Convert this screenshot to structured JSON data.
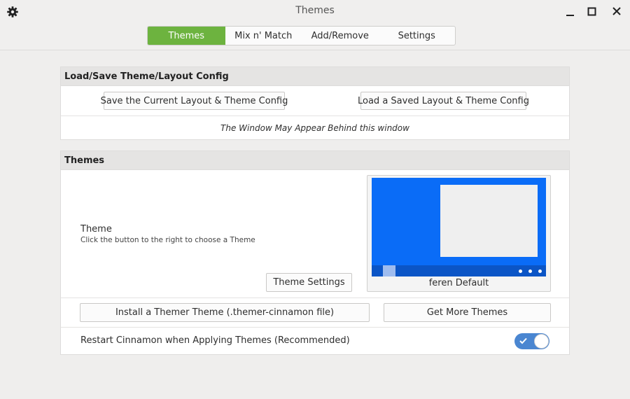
{
  "window": {
    "title": "Themes",
    "icons": {
      "settings": "gear-icon",
      "minimize": "minimize-icon",
      "maximize": "maximize-icon",
      "close": "close-icon"
    }
  },
  "tabs": [
    {
      "label": "Themes",
      "active": true
    },
    {
      "label": "Mix n' Match",
      "active": false
    },
    {
      "label": "Add/Remove",
      "active": false
    },
    {
      "label": "Settings",
      "active": false
    }
  ],
  "config_section": {
    "header": "Load/Save Theme/Layout Config",
    "save_button": "Save the Current Layout & Theme Config",
    "load_button": "Load a Saved Layout & Theme Config",
    "note": "The Window May Appear Behind this window"
  },
  "themes_section": {
    "header": "Themes",
    "theme_label": "Theme",
    "theme_hint": "Click the button to the right to choose a Theme",
    "theme_settings_button": "Theme Settings",
    "preview_name": "feren Default",
    "install_button": "Install a Themer Theme (.themer-cinnamon file)",
    "get_more_button": "Get More Themes",
    "restart_label": "Restart Cinnamon when Applying Themes (Recommended)",
    "restart_enabled": true
  },
  "colors": {
    "accent_tab": "#6db33f",
    "toggle_on": "#4a86d1",
    "preview_desktop": "#0a6cf7",
    "preview_panel": "#0b55c6"
  }
}
